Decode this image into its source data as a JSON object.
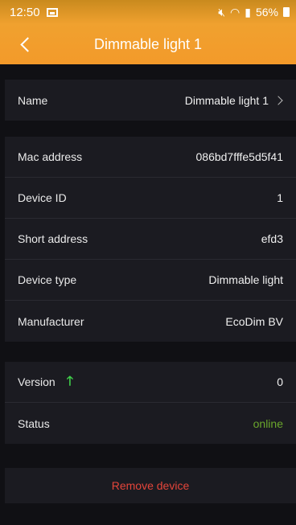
{
  "status_bar": {
    "time": "12:50",
    "battery": "56%"
  },
  "header": {
    "title": "Dimmable light 1"
  },
  "name_row": {
    "label": "Name",
    "value": "Dimmable light 1"
  },
  "details": [
    {
      "label": "Mac address",
      "value": "086bd7fffe5d5f41"
    },
    {
      "label": "Device ID",
      "value": "1"
    },
    {
      "label": "Short address",
      "value": "efd3"
    },
    {
      "label": "Device type",
      "value": "Dimmable light"
    },
    {
      "label": "Manufacturer",
      "value": "EcoDim BV"
    }
  ],
  "version": {
    "label": "Version",
    "value": "0"
  },
  "status": {
    "label": "Status",
    "value": "online"
  },
  "remove_label": "Remove device",
  "colors": {
    "header": "#f39a2a",
    "online": "#6aa62c",
    "remove": "#e4453a",
    "update_arrow": "#3fcf4a"
  },
  "icons": [
    "image-icon",
    "mute-icon",
    "wifi-icon",
    "signal-icon",
    "battery-icon",
    "back-icon",
    "chevron-right-icon",
    "arrow-up-icon"
  ]
}
